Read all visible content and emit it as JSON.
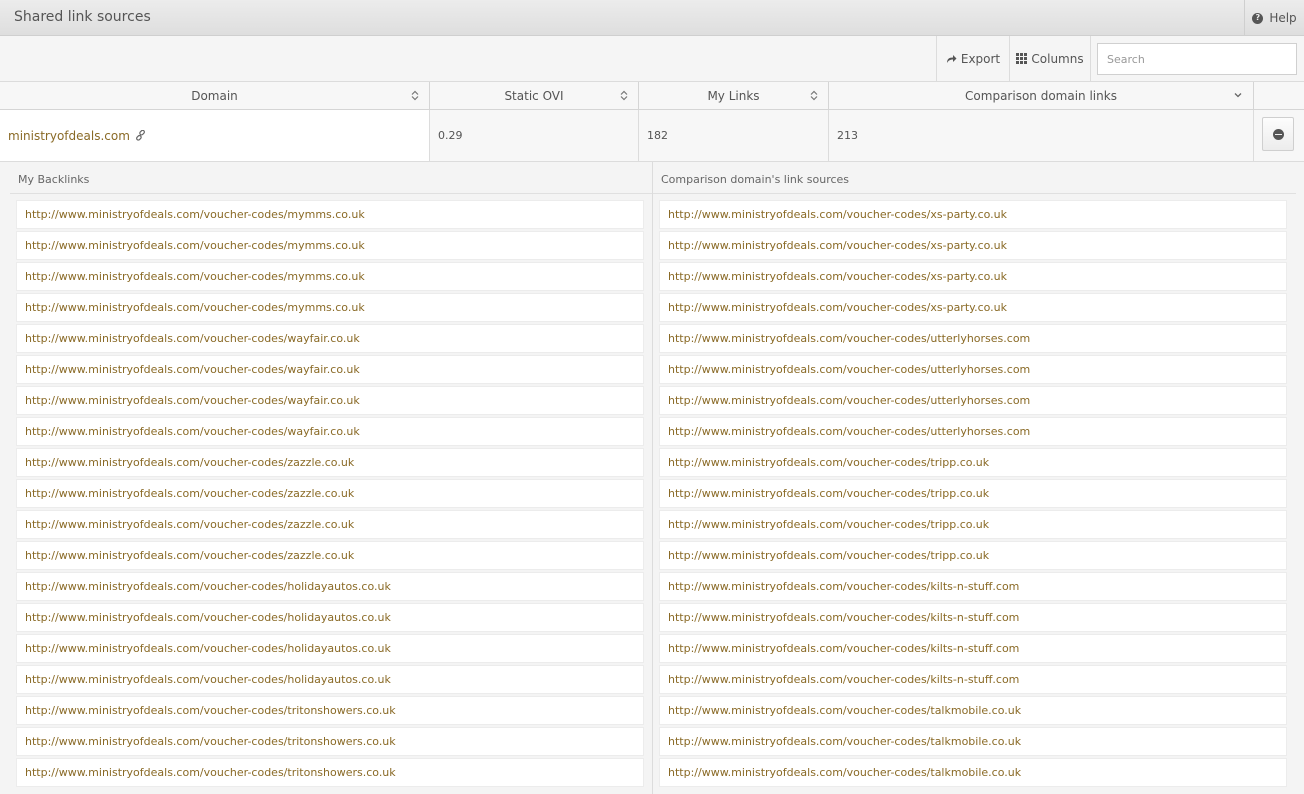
{
  "header": {
    "title": "Shared link sources",
    "help_label": "Help"
  },
  "toolbar": {
    "export_label": "Export",
    "columns_label": "Columns",
    "search_placeholder": "Search",
    "search_value": ""
  },
  "table": {
    "columns": [
      "Domain",
      "Static OVI",
      "My Links",
      "Comparison domain links"
    ],
    "row": {
      "domain": "ministryofdeals.com",
      "static_ovi": "0.29",
      "my_links": "182",
      "comparison_links": "213"
    }
  },
  "panels": {
    "left_title": "My Backlinks",
    "right_title": "Comparison domain's link sources",
    "my_backlinks": [
      "http://www.ministryofdeals.com/voucher-codes/mymms.co.uk",
      "http://www.ministryofdeals.com/voucher-codes/mymms.co.uk",
      "http://www.ministryofdeals.com/voucher-codes/mymms.co.uk",
      "http://www.ministryofdeals.com/voucher-codes/mymms.co.uk",
      "http://www.ministryofdeals.com/voucher-codes/wayfair.co.uk",
      "http://www.ministryofdeals.com/voucher-codes/wayfair.co.uk",
      "http://www.ministryofdeals.com/voucher-codes/wayfair.co.uk",
      "http://www.ministryofdeals.com/voucher-codes/wayfair.co.uk",
      "http://www.ministryofdeals.com/voucher-codes/zazzle.co.uk",
      "http://www.ministryofdeals.com/voucher-codes/zazzle.co.uk",
      "http://www.ministryofdeals.com/voucher-codes/zazzle.co.uk",
      "http://www.ministryofdeals.com/voucher-codes/zazzle.co.uk",
      "http://www.ministryofdeals.com/voucher-codes/holidayautos.co.uk",
      "http://www.ministryofdeals.com/voucher-codes/holidayautos.co.uk",
      "http://www.ministryofdeals.com/voucher-codes/holidayautos.co.uk",
      "http://www.ministryofdeals.com/voucher-codes/holidayautos.co.uk",
      "http://www.ministryofdeals.com/voucher-codes/tritonshowers.co.uk",
      "http://www.ministryofdeals.com/voucher-codes/tritonshowers.co.uk",
      "http://www.ministryofdeals.com/voucher-codes/tritonshowers.co.uk"
    ],
    "comparison_sources": [
      "http://www.ministryofdeals.com/voucher-codes/xs-party.co.uk",
      "http://www.ministryofdeals.com/voucher-codes/xs-party.co.uk",
      "http://www.ministryofdeals.com/voucher-codes/xs-party.co.uk",
      "http://www.ministryofdeals.com/voucher-codes/xs-party.co.uk",
      "http://www.ministryofdeals.com/voucher-codes/utterlyhorses.com",
      "http://www.ministryofdeals.com/voucher-codes/utterlyhorses.com",
      "http://www.ministryofdeals.com/voucher-codes/utterlyhorses.com",
      "http://www.ministryofdeals.com/voucher-codes/utterlyhorses.com",
      "http://www.ministryofdeals.com/voucher-codes/tripp.co.uk",
      "http://www.ministryofdeals.com/voucher-codes/tripp.co.uk",
      "http://www.ministryofdeals.com/voucher-codes/tripp.co.uk",
      "http://www.ministryofdeals.com/voucher-codes/tripp.co.uk",
      "http://www.ministryofdeals.com/voucher-codes/kilts-n-stuff.com",
      "http://www.ministryofdeals.com/voucher-codes/kilts-n-stuff.com",
      "http://www.ministryofdeals.com/voucher-codes/kilts-n-stuff.com",
      "http://www.ministryofdeals.com/voucher-codes/kilts-n-stuff.com",
      "http://www.ministryofdeals.com/voucher-codes/talkmobile.co.uk",
      "http://www.ministryofdeals.com/voucher-codes/talkmobile.co.uk",
      "http://www.ministryofdeals.com/voucher-codes/talkmobile.co.uk"
    ]
  },
  "colors": {
    "link": "#8a6a26",
    "text": "#555555",
    "header_bg": "#e4e4e4"
  },
  "icons": [
    "help-icon",
    "export-icon",
    "columns-icon",
    "sort-icon",
    "chevron-down-icon",
    "link-chain-icon",
    "collapse-icon"
  ]
}
